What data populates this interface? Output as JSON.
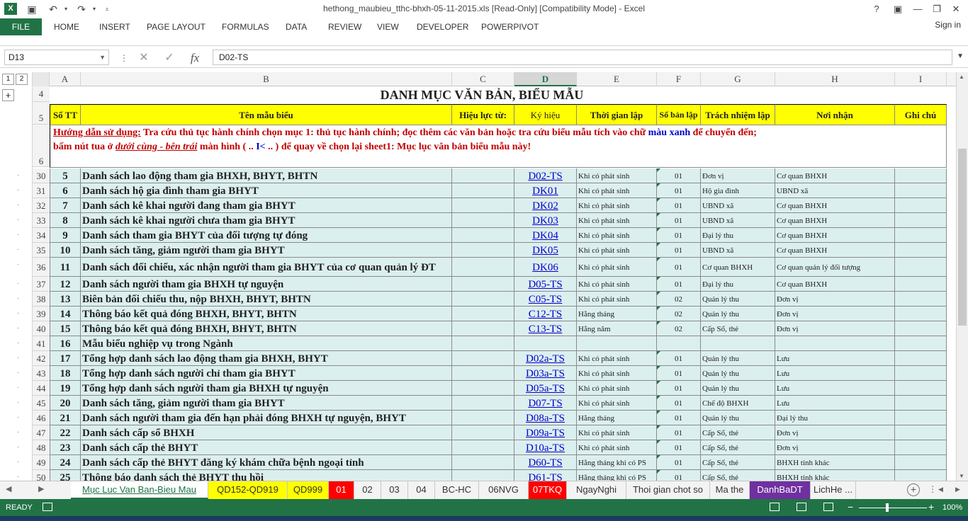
{
  "window": {
    "title": "hethong_maubieu_tthc-bhxh-05-11-2015.xls  [Read-Only]  [Compatibility Mode] - Excel",
    "help": "?",
    "minimize": "—",
    "restore": "❐",
    "close": "✕",
    "ribbon_options": "▣"
  },
  "ribbon": {
    "file": "FILE",
    "tabs": [
      "HOME",
      "INSERT",
      "PAGE LAYOUT",
      "FORMULAS",
      "DATA",
      "REVIEW",
      "VIEW",
      "DEVELOPER",
      "POWERPIVOT"
    ],
    "signin": "Sign in"
  },
  "formula_bar": {
    "name_box": "D13",
    "content": "D02-TS"
  },
  "outline": {
    "levels": [
      "1",
      "2"
    ],
    "expand": "+"
  },
  "columns": [
    "A",
    "B",
    "C",
    "D",
    "E",
    "F",
    "G",
    "H",
    "I"
  ],
  "sheet": {
    "title": "DANH MỤC VĂN BẢN, BIỂU MẪU",
    "headers": [
      "Số TT",
      "Tên mẫu biểu",
      "Hiệu lực từ:",
      "Ký hiệu",
      "Thời gian lập",
      "Số bản lập",
      "Trách nhiệm lập",
      "Nơi nhận",
      "Ghi chú"
    ],
    "note_line1_label": "Hướng dẫn sử dụng:",
    "note_line1_text": " Tra cứu thủ tục hành chính chọn mục 1: thủ tục hành chính; đọc thêm các văn bản hoặc tra cứu biểu mẫu tích vào chữ ",
    "note_line1_blue": "màu xanh",
    "note_line1_end": " để chuyển đến;",
    "note_line2_a": " bấm nút tua ở ",
    "note_line2_u": "dưới cùng - bên trái",
    "note_line2_b": "  màn hình ( .. ",
    "note_line2_c": "I<",
    "note_line2_d": " .. ) để quay về chọn lại sheet1: Mục lục văn bản biểu mẫu này!"
  },
  "row_numbers_top": [
    "4",
    "5",
    "6"
  ],
  "rows": [
    {
      "r": "30",
      "stt": "5",
      "name": "Danh sách lao động tham gia BHXH, BHYT, BHTN",
      "code": "D02-TS",
      "time": "Khi có phát sinh",
      "copies": "01",
      "resp": "Đơn vị",
      "recv": "Cơ quan BHXH"
    },
    {
      "r": "31",
      "stt": "6",
      "name": "Danh sách hộ gia đình tham gia BHYT",
      "code": "DK01",
      "time": "Khi có phát sinh",
      "copies": "01",
      "resp": "Hộ gia đình",
      "recv": "UBND xã"
    },
    {
      "r": "32",
      "stt": "7",
      "name": "Danh sách kê khai người đang tham gia BHYT",
      "code": "DK02",
      "time": "Khi có phát sinh",
      "copies": "01",
      "resp": "UBND xã",
      "recv": "Cơ quan BHXH"
    },
    {
      "r": "33",
      "stt": "8",
      "name": "Danh sách kê khai người chưa tham gia BHYT",
      "code": "DK03",
      "time": "Khi có phát sinh",
      "copies": "01",
      "resp": "UBND xã",
      "recv": "Cơ quan BHXH"
    },
    {
      "r": "34",
      "stt": "9",
      "name": "Danh sách tham gia BHYT của đối tượng tự đóng",
      "code": "DK04",
      "time": "Khi có phát sinh",
      "copies": "01",
      "resp": "Đại lý thu",
      "recv": "Cơ quan BHXH"
    },
    {
      "r": "35",
      "stt": "10",
      "name": "Danh sách tăng, giảm người tham gia BHYT",
      "code": "DK05",
      "time": "Khi có phát sinh",
      "copies": "01",
      "resp": "UBND xã",
      "recv": "Cơ quan BHXH"
    },
    {
      "r": "36",
      "stt": "11",
      "name": "Danh sách đối chiếu, xác nhận người tham gia BHYT của cơ quan quản lý ĐT",
      "code": "DK06",
      "time": "Khi có phát sinh",
      "copies": "01",
      "resp": "Cơ quan BHXH",
      "recv": "Cơ quan quản lý đối tượng"
    },
    {
      "r": "37",
      "stt": "12",
      "name": "Danh sách người tham gia BHXH tự nguyện",
      "code": "D05-TS",
      "time": "Khi có phát sinh",
      "copies": "01",
      "resp": "Đại lý thu",
      "recv": "Cơ quan BHXH"
    },
    {
      "r": "38",
      "stt": "13",
      "name": "Biên bản đối chiếu thu, nộp BHXH, BHYT, BHTN",
      "code": "C05-TS",
      "time": "Khi có phát sinh",
      "copies": "02",
      "resp": "Quản lý thu",
      "recv": "Đơn vị"
    },
    {
      "r": "39",
      "stt": "14",
      "name": "Thông báo kết quả đóng BHXH, BHYT, BHTN",
      "code": "C12-TS",
      "time": "Hằng tháng",
      "copies": "02",
      "resp": "Quản lý thu",
      "recv": "Đơn vị"
    },
    {
      "r": "40",
      "stt": "15",
      "name": "Thông báo kết quả đóng BHXH, BHYT, BHTN",
      "code": "C13-TS",
      "time": "Hằng năm",
      "copies": "02",
      "resp": "Cấp Sổ, thẻ",
      "recv": "Đơn vị"
    },
    {
      "r": "41",
      "stt": "16",
      "name": "Mẫu biểu nghiệp vụ trong Ngành",
      "code": "",
      "time": "",
      "copies": "",
      "resp": "",
      "recv": ""
    },
    {
      "r": "42",
      "stt": "17",
      "name": "Tổng hợp danh sách lao động tham gia BHXH, BHYT",
      "code": "D02a-TS",
      "time": "Khi có phát sinh",
      "copies": "01",
      "resp": "Quản lý thu",
      "recv": "Lưu"
    },
    {
      "r": "43",
      "stt": "18",
      "name": "Tổng hợp danh sách người chỉ tham gia BHYT",
      "code": "D03a-TS",
      "time": "Khi có phát sinh",
      "copies": "01",
      "resp": "Quản lý thu",
      "recv": "Lưu"
    },
    {
      "r": "44",
      "stt": "19",
      "name": "Tổng hợp danh sách người tham gia BHXH tự nguyện",
      "code": "D05a-TS",
      "time": "Khi có phát sinh",
      "copies": "01",
      "resp": "Quản lý thu",
      "recv": "Lưu"
    },
    {
      "r": "45",
      "stt": "20",
      "name": "Danh sách tăng, giảm người tham gia BHYT",
      "code": "D07-TS",
      "time": "Khi có phát sinh",
      "copies": "01",
      "resp": "Chế độ BHXH",
      "recv": "Lưu"
    },
    {
      "r": "46",
      "stt": "21",
      "name": "Danh sách người tham gia đến hạn phải đóng BHXH tự nguyện, BHYT",
      "code": "D08a-TS",
      "time": "Hằng tháng",
      "copies": "01",
      "resp": "Quản lý thu",
      "recv": "Đại lý thu"
    },
    {
      "r": "47",
      "stt": "22",
      "name": "Danh sách cấp sổ BHXH",
      "code": "D09a-TS",
      "time": "Khi có phát sinh",
      "copies": "01",
      "resp": "Cấp Sổ, thẻ",
      "recv": "Đơn vị"
    },
    {
      "r": "48",
      "stt": "23",
      "name": "Danh sách cấp thẻ BHYT",
      "code": "D10a-TS",
      "time": "Khi có phát sinh",
      "copies": "01",
      "resp": "Cấp Sổ, thẻ",
      "recv": "Đơn vị"
    },
    {
      "r": "49",
      "stt": "24",
      "name": "Danh sách cấp thẻ BHYT đăng ký khám chữa bệnh ngoại tỉnh",
      "code": "D60-TS",
      "time": "Hằng tháng khi có PS",
      "copies": "01",
      "resp": "Cấp Sổ, thẻ",
      "recv": "BHXH tỉnh khác"
    },
    {
      "r": "50",
      "stt": "25",
      "name": "Thông báo danh sách thẻ BHYT thu hồi",
      "code": "D61-TS",
      "time": "Hằng tháng khi có PS",
      "copies": "01",
      "resp": "Cấp Sổ, thẻ",
      "recv": "BHXH tỉnh khác"
    }
  ],
  "sheet_tabs": [
    {
      "label": "Mục Luc Van Ban-Bieu Mau",
      "color": "",
      "active": true
    },
    {
      "label": "QD152-QD919",
      "color": "#ffff00"
    },
    {
      "label": "QD999",
      "color": "#ffff00"
    },
    {
      "label": "01",
      "color": "#ff0000"
    },
    {
      "label": "02",
      "color": ""
    },
    {
      "label": "03",
      "color": ""
    },
    {
      "label": "04",
      "color": ""
    },
    {
      "label": "BC-HC",
      "color": ""
    },
    {
      "label": "06NVG",
      "color": ""
    },
    {
      "label": "07TKQ",
      "color": "#ff0000"
    },
    {
      "label": "NgayNghi",
      "color": ""
    },
    {
      "label": "Thoi gian chot so",
      "color": ""
    },
    {
      "label": "Ma the",
      "color": ""
    },
    {
      "label": "DanhBaDT",
      "color": "#7030a0"
    },
    {
      "label": "LichHe ...",
      "color": ""
    }
  ],
  "status": {
    "ready": "READY",
    "zoom": "100%",
    "zoom_minus": "−",
    "zoom_plus": "+"
  },
  "colors": {
    "excel_green": "#217346",
    "header_yellow": "#ffff00",
    "row_teal": "#dcefef",
    "link_blue": "#0000cc",
    "note_red": "#c00000"
  }
}
